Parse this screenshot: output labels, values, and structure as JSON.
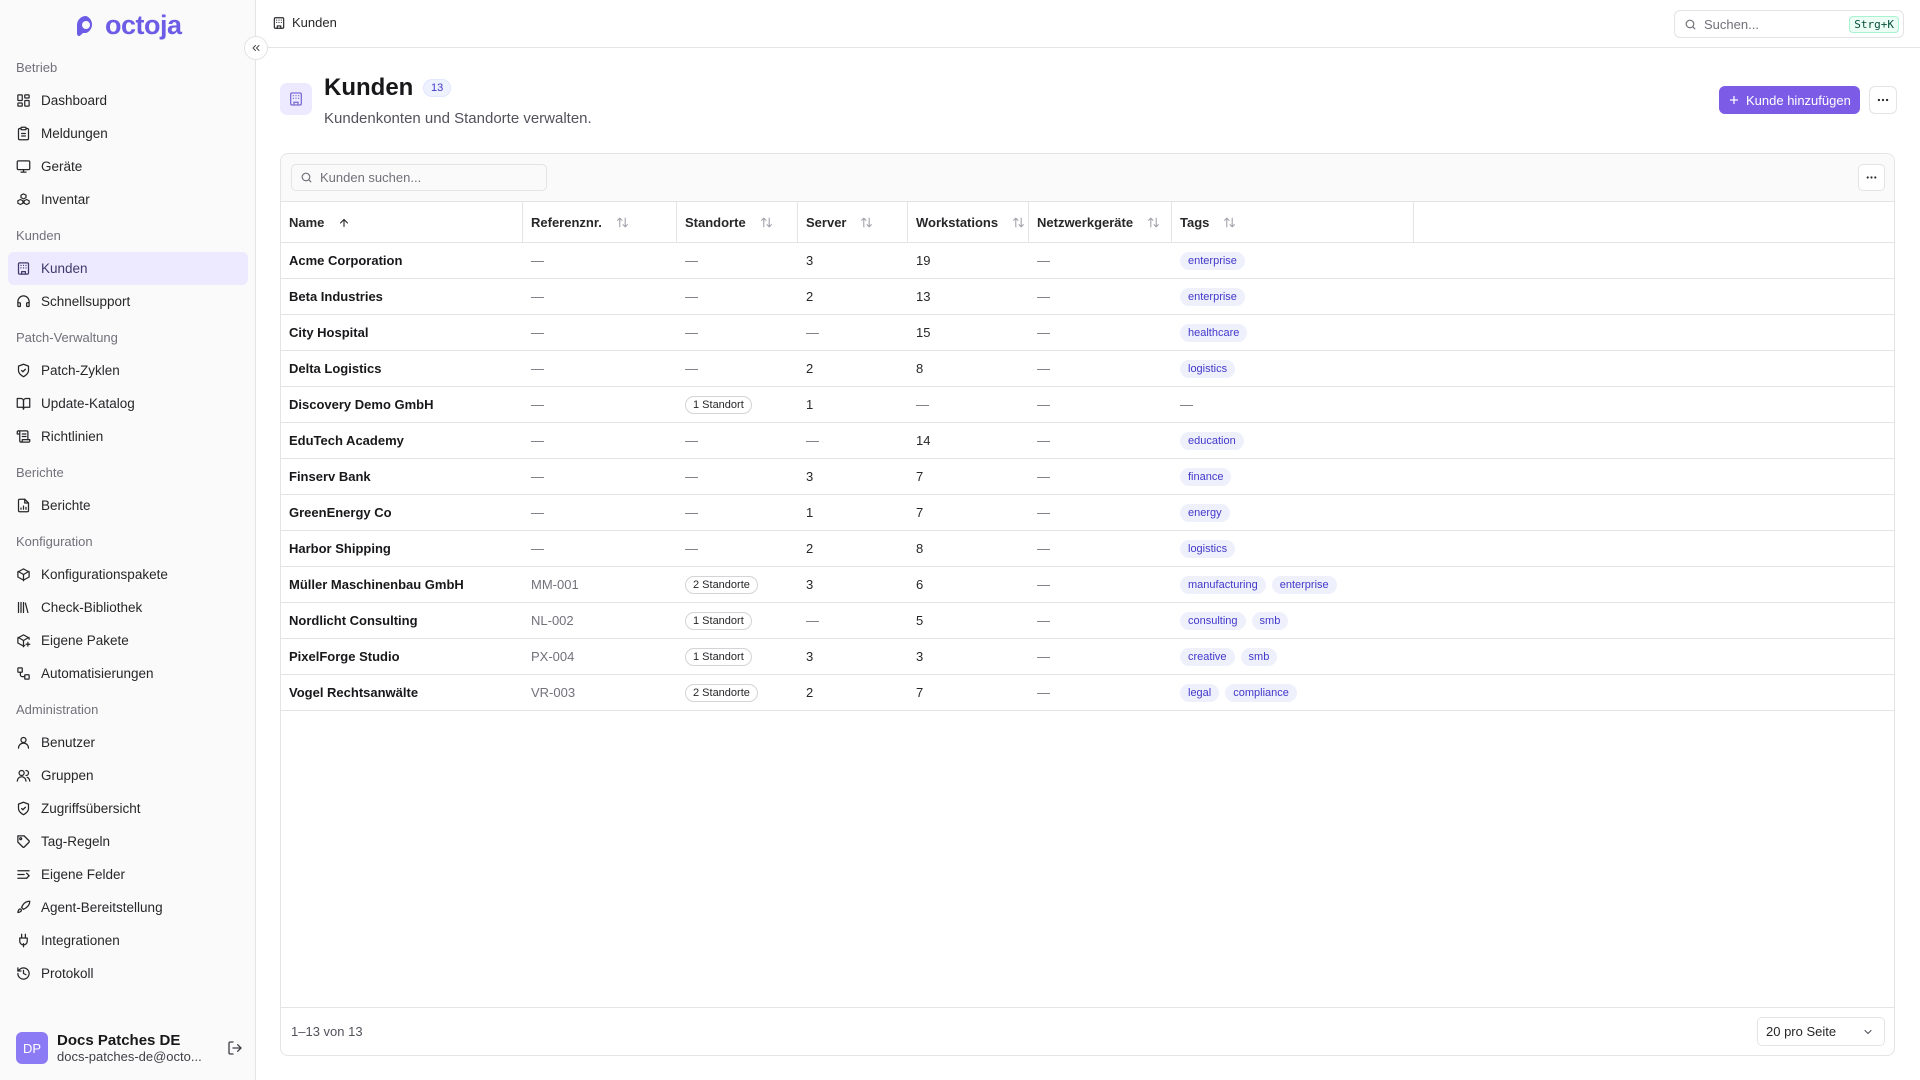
{
  "brand": {
    "name": "octoja",
    "color": "#6d5ce6"
  },
  "sidebar": {
    "groups": [
      {
        "label": "Betrieb",
        "items": [
          {
            "label": "Dashboard",
            "icon": "dashboard-icon"
          },
          {
            "label": "Meldungen",
            "icon": "clipboard-icon"
          },
          {
            "label": "Geräte",
            "icon": "monitor-icon"
          },
          {
            "label": "Inventar",
            "icon": "boxes-icon"
          }
        ]
      },
      {
        "label": "Kunden",
        "items": [
          {
            "label": "Kunden",
            "icon": "building-icon",
            "active": true
          },
          {
            "label": "Schnellsupport",
            "icon": "headset-icon"
          }
        ]
      },
      {
        "label": "Patch-Verwaltung",
        "items": [
          {
            "label": "Patch-Zyklen",
            "icon": "shield-check-icon"
          },
          {
            "label": "Update-Katalog",
            "icon": "book-open-icon"
          },
          {
            "label": "Richtlinien",
            "icon": "scroll-icon"
          }
        ]
      },
      {
        "label": "Berichte",
        "items": [
          {
            "label": "Berichte",
            "icon": "file-chart-icon"
          }
        ]
      },
      {
        "label": "Konfiguration",
        "items": [
          {
            "label": "Konfigurationspakete",
            "icon": "package-icon"
          },
          {
            "label": "Check-Bibliothek",
            "icon": "library-icon"
          },
          {
            "label": "Eigene Pakete",
            "icon": "package-plus-icon"
          },
          {
            "label": "Automatisierungen",
            "icon": "workflow-icon"
          }
        ]
      },
      {
        "label": "Administration",
        "items": [
          {
            "label": "Benutzer",
            "icon": "user-icon"
          },
          {
            "label": "Gruppen",
            "icon": "users-icon"
          },
          {
            "label": "Zugriffsübersicht",
            "icon": "shield-icon"
          },
          {
            "label": "Tag-Regeln",
            "icon": "tag-icon"
          },
          {
            "label": "Eigene Felder",
            "icon": "text-fields-icon"
          },
          {
            "label": "Agent-Bereitstellung",
            "icon": "rocket-icon"
          },
          {
            "label": "Integrationen",
            "icon": "plug-icon"
          },
          {
            "label": "Protokoll",
            "icon": "history-icon"
          }
        ]
      }
    ]
  },
  "user": {
    "initials": "DP",
    "name": "Docs Patches DE",
    "email": "docs-patches-de@octo..."
  },
  "topbar": {
    "breadcrumb": "Kunden",
    "search_placeholder": "Suchen...",
    "shortcut": "Strg+K"
  },
  "page": {
    "title": "Kunden",
    "count": "13",
    "subtitle": "Kundenkonten und Standorte verwalten.",
    "add_button": "Kunde hinzufügen",
    "accent": "#7c5ce6"
  },
  "table": {
    "search_placeholder": "Kunden suchen...",
    "columns": [
      "Name",
      "Referenznr.",
      "Standorte",
      "Server",
      "Workstations",
      "Netzwerkgeräte",
      "Tags"
    ],
    "rows": [
      {
        "name": "Acme Corporation",
        "ref": "—",
        "sites": "—",
        "servers": "3",
        "workstations": "19",
        "network": "—",
        "tags": [
          "enterprise"
        ]
      },
      {
        "name": "Beta Industries",
        "ref": "—",
        "sites": "—",
        "servers": "2",
        "workstations": "13",
        "network": "—",
        "tags": [
          "enterprise"
        ]
      },
      {
        "name": "City Hospital",
        "ref": "—",
        "sites": "—",
        "servers": "—",
        "workstations": "15",
        "network": "—",
        "tags": [
          "healthcare"
        ]
      },
      {
        "name": "Delta Logistics",
        "ref": "—",
        "sites": "—",
        "servers": "2",
        "workstations": "8",
        "network": "—",
        "tags": [
          "logistics"
        ]
      },
      {
        "name": "Discovery Demo GmbH",
        "ref": "—",
        "sites": "1 Standort",
        "servers": "1",
        "workstations": "—",
        "network": "—",
        "tags": []
      },
      {
        "name": "EduTech Academy",
        "ref": "—",
        "sites": "—",
        "servers": "—",
        "workstations": "14",
        "network": "—",
        "tags": [
          "education"
        ]
      },
      {
        "name": "Finserv Bank",
        "ref": "—",
        "sites": "—",
        "servers": "3",
        "workstations": "7",
        "network": "—",
        "tags": [
          "finance"
        ]
      },
      {
        "name": "GreenEnergy Co",
        "ref": "—",
        "sites": "—",
        "servers": "1",
        "workstations": "7",
        "network": "—",
        "tags": [
          "energy"
        ]
      },
      {
        "name": "Harbor Shipping",
        "ref": "—",
        "sites": "—",
        "servers": "2",
        "workstations": "8",
        "network": "—",
        "tags": [
          "logistics"
        ]
      },
      {
        "name": "Müller Maschinenbau GmbH",
        "ref": "MM-001",
        "sites": "2 Standorte",
        "servers": "3",
        "workstations": "6",
        "network": "—",
        "tags": [
          "manufacturing",
          "enterprise"
        ]
      },
      {
        "name": "Nordlicht Consulting",
        "ref": "NL-002",
        "sites": "1 Standort",
        "servers": "—",
        "workstations": "5",
        "network": "—",
        "tags": [
          "consulting",
          "smb"
        ]
      },
      {
        "name": "PixelForge Studio",
        "ref": "PX-004",
        "sites": "1 Standort",
        "servers": "3",
        "workstations": "3",
        "network": "—",
        "tags": [
          "creative",
          "smb"
        ]
      },
      {
        "name": "Vogel Rechtsanwälte",
        "ref": "VR-003",
        "sites": "2 Standorte",
        "servers": "2",
        "workstations": "7",
        "network": "—",
        "tags": [
          "legal",
          "compliance"
        ]
      }
    ],
    "range": "1–13 von 13",
    "per_page": "20 pro Seite"
  }
}
